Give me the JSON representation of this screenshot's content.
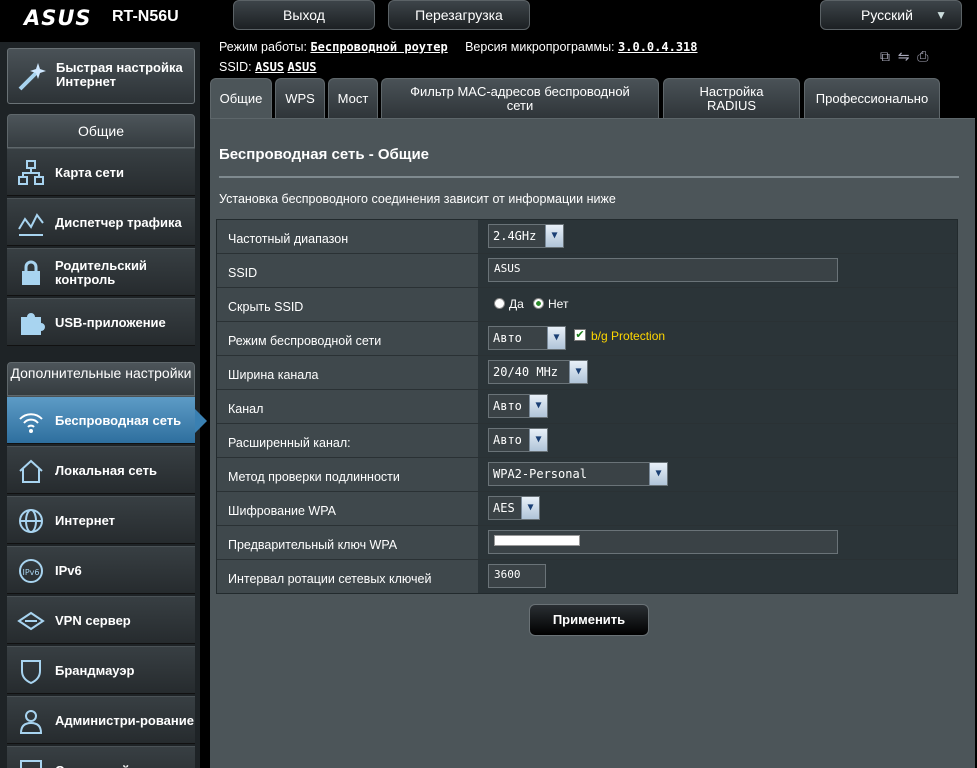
{
  "header": {
    "brand": "ASUS",
    "model": "RT-N56U",
    "logout_label": "Выход",
    "reboot_label": "Перезагрузка",
    "language": "Русский"
  },
  "info": {
    "mode_label": "Режим работы:",
    "mode_value": "Беспроводной роутер",
    "fw_label": "Версия микропрограммы:",
    "fw_value": "3.0.0.4.318",
    "ssid_label": "SSID:",
    "ssid_value1": "ASUS",
    "ssid_value2": "ASUS"
  },
  "sidebar": {
    "quick_setup": "Быстрая настройка Интернет",
    "general_header": "Общие",
    "general_items": [
      {
        "label": "Карта сети",
        "icon": "network-map-icon"
      },
      {
        "label": "Диспетчер трафика",
        "icon": "traffic-manager-icon"
      },
      {
        "label": "Родительский контроль",
        "icon": "lock-icon"
      },
      {
        "label": "USB-приложение",
        "icon": "puzzle-icon"
      }
    ],
    "advanced_header": "Дополнительные настройки",
    "advanced_items": [
      {
        "label": "Беспроводная сеть",
        "icon": "wifi-icon"
      },
      {
        "label": "Локальная сеть",
        "icon": "home-icon"
      },
      {
        "label": "Интернет",
        "icon": "globe-icon"
      },
      {
        "label": "IPv6",
        "icon": "ipv6-icon"
      },
      {
        "label": "VPN сервер",
        "icon": "vpn-icon"
      },
      {
        "label": "Брандмауэр",
        "icon": "shield-icon"
      },
      {
        "label": "Администри-рование",
        "icon": "admin-user-icon"
      },
      {
        "label": "Системный",
        "icon": "system-log-icon"
      }
    ]
  },
  "tabs": [
    "Общие",
    "WPS",
    "Мост",
    "Фильтр MAC-адресов беспроводной сети",
    "Настройка RADIUS",
    "Профессионально"
  ],
  "main": {
    "title": "Беспроводная сеть - Общие",
    "description": "Установка беспроводного соединения зависит от информации ниже",
    "apply_label": "Применить"
  },
  "form": {
    "band_label": "Частотный диапазон",
    "band_value": "2.4GHz",
    "ssid_label": "SSID",
    "ssid_value": "ASUS",
    "hide_ssid_label": "Скрыть SSID",
    "yes_label": "Да",
    "no_label": "Нет",
    "mode_label": "Режим беспроводной сети",
    "mode_value": "Авто",
    "bg_protection_label": "b/g Protection",
    "width_label": "Ширина канала",
    "width_value": "20/40 MHz",
    "channel_label": "Канал",
    "channel_value": "Авто",
    "ext_channel_label": "Расширенный канал:",
    "ext_channel_value": "Авто",
    "auth_label": "Метод проверки подлинности",
    "auth_value": "WPA2-Personal",
    "enc_label": "Шифрование WPA",
    "enc_value": "AES",
    "psk_label": "Предварительный ключ WPA",
    "rekey_label": "Интервал ротации сетевых ключей",
    "rekey_value": "3600"
  }
}
